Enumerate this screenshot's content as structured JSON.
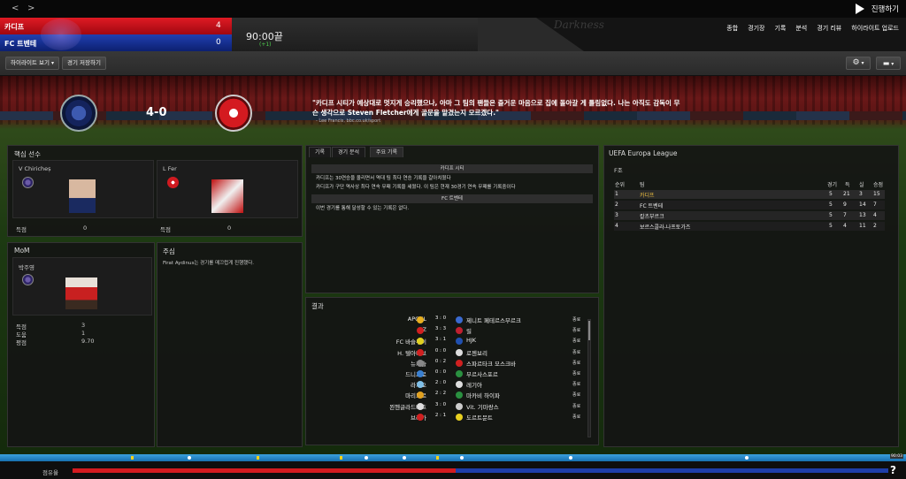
{
  "topbar": {
    "back_glyph": "<",
    "forward_glyph": ">",
    "proceed_label": "진행하기"
  },
  "scoreboard": {
    "home_name": "카디프",
    "home_score": "4",
    "away_name": "FC 트벤테",
    "away_score": "0",
    "clock": "90:00끝",
    "added_time": "(+1)",
    "brand": "Darkness"
  },
  "topnav": {
    "items": [
      "종합",
      "경기장",
      "기록",
      "분석",
      "경기 리뷰",
      "하이라이트 업로드"
    ]
  },
  "toolbar": {
    "highlights_label": "하이라이트 보기",
    "save_match_label": "경기 저장하기",
    "settings_icon": "gear-icon",
    "chat_icon": "speech-bubble-icon"
  },
  "header": {
    "score": "4-0",
    "quote": "\"카디프 시티가 예상대로 멋지게 승리했으나, 아마 그 팀의 팬들은 즐거운 마음으로 집에 돌아갈 게 틀림없다. 나는 아직도 감독이 무슨 생각으로 Steven Fletcher에게 골문을 맡겼는지 모르겠다.\"",
    "quote_source": "- Lee Francis, bbc.co.uk/sport"
  },
  "key_players": {
    "title": "핵심 선수",
    "home": {
      "name": "V Chiricheș",
      "stat_label": "득점",
      "stat_value": "0"
    },
    "away": {
      "name": "L Fer",
      "stat_label": "득점",
      "stat_value": "0"
    }
  },
  "mom": {
    "title": "MoM",
    "name": "박주영",
    "stats": [
      {
        "label": "득점",
        "value": "3"
      },
      {
        "label": "도움",
        "value": "1"
      },
      {
        "label": "평점",
        "value": "9.70"
      }
    ]
  },
  "referee": {
    "title": "주심",
    "text": "Firat Aydinus는 경기를 매끄럽게 진행했다."
  },
  "report": {
    "tabs": [
      "기록",
      "경기 분석",
      "주요 기록"
    ],
    "home_header": "카디프 시티",
    "home_lines": [
      "카디프는 30연승을 올리면서 역대 팀 최다 연승 기록을 갈아치웠다",
      "카디프가 구단 역사상 최다 연속 무패 기록을 세웠다. 이 팀은 현재 30경기 연속 무패를 기록중이다"
    ],
    "away_header": "FC 트벤테",
    "away_lines": [
      "이번 경기를 통해 달성할 수 있는 기록은 없다."
    ]
  },
  "results": {
    "title": "결과",
    "rows": [
      {
        "home": "APOEL",
        "score": "3 : 0",
        "away": "제니트 페테르스부르크",
        "status": "종료",
        "hc": "#e8b020",
        "ac": "#3a6ad0"
      },
      {
        "home": "AZ",
        "score": "3 : 3",
        "away": "릴",
        "status": "종료",
        "hc": "#d02020",
        "ac": "#c02030"
      },
      {
        "home": "FC 바슬루이",
        "score": "3 : 1",
        "away": "HJK",
        "status": "종료",
        "hc": "#e0d020",
        "ac": "#2050b0"
      },
      {
        "home": "H. 텔아비브",
        "score": "0 : 0",
        "away": "로젠보리",
        "status": "종료",
        "hc": "#d02020",
        "ac": "#ddd"
      },
      {
        "home": "뉴캐슬",
        "score": "0 : 2",
        "away": "스파르타크 모스크바",
        "status": "종료",
        "hc": "#888",
        "ac": "#d02020"
      },
      {
        "home": "드니프로",
        "score": "0 : 0",
        "away": "부르사스포르",
        "status": "종료",
        "hc": "#3a80d0",
        "ac": "#2a9040"
      },
      {
        "home": "라치오",
        "score": "2 : 0",
        "away": "레기아",
        "status": "종료",
        "hc": "#80c0e8",
        "ac": "#ddd"
      },
      {
        "home": "마리보르",
        "score": "2 : 2",
        "away": "마카비 하이파",
        "status": "종료",
        "hc": "#e0a020",
        "ac": "#2a9040"
      },
      {
        "home": "묀헨글라드바흐",
        "score": "3 : 0",
        "away": "Vit. 기마랑스",
        "status": "종료",
        "hc": "#ddd",
        "ac": "#ccc"
      },
      {
        "home": "브라가",
        "score": "2 : 1",
        "away": "도르트문트",
        "status": "종료",
        "hc": "#d02020",
        "ac": "#e8d020"
      }
    ]
  },
  "standings": {
    "competition": "UEFA Europa League",
    "group": "F조",
    "columns": [
      "순위",
      "팀",
      "경기",
      "득",
      "실",
      "승점"
    ],
    "rows": [
      {
        "pos": "1",
        "team": "카디프",
        "p": "5",
        "gf": "21",
        "ga": "3",
        "pts": "15"
      },
      {
        "pos": "2",
        "team": "FC 트벤테",
        "p": "5",
        "gf": "9",
        "ga": "14",
        "pts": "7"
      },
      {
        "pos": "3",
        "team": "칼츠부르크",
        "p": "5",
        "gf": "7",
        "ga": "13",
        "pts": "4"
      },
      {
        "pos": "4",
        "team": "보르스콜라-나프토가즈",
        "p": "5",
        "gf": "4",
        "ga": "11",
        "pts": "2"
      }
    ]
  },
  "footer": {
    "possession_label": "점유율",
    "home_possession_pct": 47,
    "timeline_end": "90:03",
    "help_glyph": "?"
  },
  "colors": {
    "home": "#d31b20",
    "away": "#1e3ea8",
    "timeline": "#2a8ad0"
  }
}
